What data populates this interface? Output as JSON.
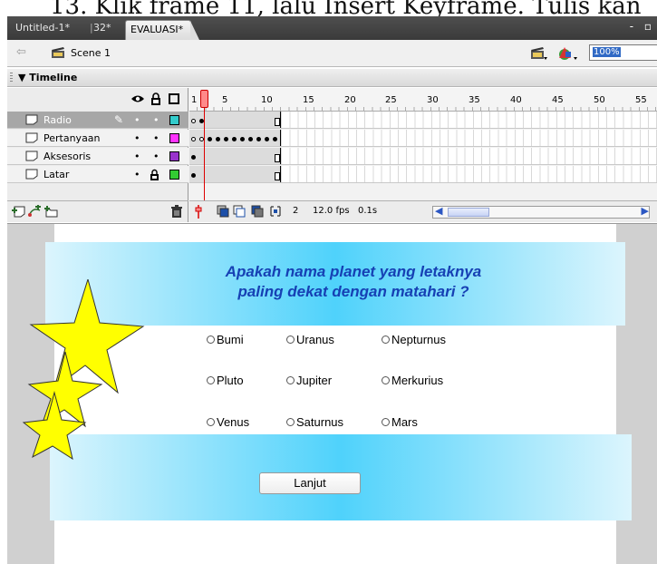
{
  "heading_overlap": "13. Klik frame 11, lalu Insert Keyframe. Tulis kan",
  "tabs": [
    {
      "label": "Untitled-1*"
    },
    {
      "label": "32*"
    },
    {
      "label": "EVALUASI*"
    }
  ],
  "tab_separator": "|",
  "window_controls": "- ▫",
  "scene": {
    "label": "Scene 1",
    "zoom": "100%"
  },
  "timeline": {
    "title": "Timeline",
    "ruler_numbers": [
      "1",
      "5",
      "10",
      "15",
      "20",
      "25",
      "30",
      "35",
      "40",
      "45",
      "50",
      "55"
    ],
    "layers": [
      {
        "name": "Radio",
        "swatch": "#33cccc",
        "selected": true,
        "locked": false
      },
      {
        "name": "Pertanyaan",
        "swatch": "#ff33ff",
        "selected": false,
        "locked": false
      },
      {
        "name": "Aksesoris",
        "swatch": "#9933cc",
        "selected": false,
        "locked": false
      },
      {
        "name": "Latar",
        "swatch": "#33cc33",
        "selected": false,
        "locked": true
      }
    ],
    "current_frame": "2",
    "fps": "12.0 fps",
    "elapsed": "0.1s"
  },
  "stage": {
    "question_line1": "Apakah nama planet yang letaknya",
    "question_line2": "paling dekat dengan matahari ?",
    "options": [
      "Bumi",
      "Uranus",
      "Nepturnus",
      "Pluto",
      "Jupiter",
      "Merkurius",
      "Venus",
      "Saturnus",
      "Mars"
    ],
    "next_label": "Lanjut"
  },
  "colors": {
    "panel_gradient_mid": "#4fd2fb",
    "question_text": "#1640b4",
    "star_fill": "#ffff00"
  }
}
